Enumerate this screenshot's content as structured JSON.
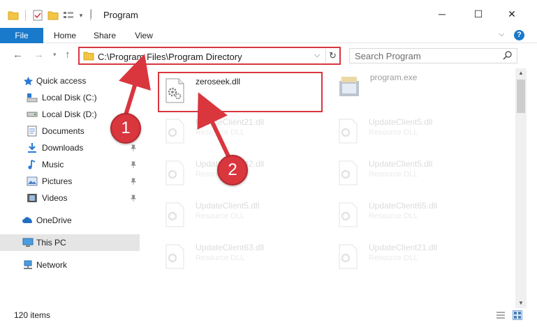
{
  "window": {
    "title": "Program",
    "minimize_glyph": "─",
    "maximize_glyph": "☐",
    "close_glyph": "✕"
  },
  "ribbon": {
    "tabs": [
      "File",
      "Home",
      "Share",
      "View"
    ],
    "expand_glyph": "⌵",
    "help_glyph": "?"
  },
  "nav": {
    "back_glyph": "←",
    "forward_glyph": "→",
    "recent_glyph": "▾",
    "up_glyph": "↑",
    "address": "C:\\Program Files\\Program Directory",
    "address_dropdown_glyph": "⌵",
    "refresh_glyph": "↻",
    "search_placeholder": "Search Program"
  },
  "sidebar": {
    "items": [
      {
        "label": "Quick access",
        "icon": "star-icon"
      },
      {
        "label": "Local Disk (C:)",
        "icon": "drive-c-icon"
      },
      {
        "label": "Local Disk (D:)",
        "icon": "drive-icon"
      },
      {
        "label": "Documents",
        "icon": "documents-icon"
      },
      {
        "label": "Downloads",
        "icon": "downloads-icon"
      },
      {
        "label": "Music",
        "icon": "music-icon"
      },
      {
        "label": "Pictures",
        "icon": "pictures-icon"
      },
      {
        "label": "Videos",
        "icon": "videos-icon"
      },
      {
        "label": "OneDrive",
        "icon": "onedrive-icon"
      },
      {
        "label": "This PC",
        "icon": "this-pc-icon"
      },
      {
        "label": "Network",
        "icon": "network-icon"
      }
    ]
  },
  "files": [
    {
      "name": "zeroseek.dll",
      "type": ""
    },
    {
      "name": "program.exe",
      "type": ""
    },
    {
      "name": "UpdateClient21.dll",
      "type": "Resource DLL"
    },
    {
      "name": "UpdateClient5.dll",
      "type": "Resource DLL"
    },
    {
      "name": "UpdateClient42.dll",
      "type": "Resource DLL"
    },
    {
      "name": "UpdateClient5.dll",
      "type": "Resource DLL"
    },
    {
      "name": "UpdateClient5.dll",
      "type": "Resource DLL"
    },
    {
      "name": "UpdateClient65.dll",
      "type": "Resource DLL"
    },
    {
      "name": "UpdateClient63.dll",
      "type": "Resource DLL"
    },
    {
      "name": "UpdateClient21.dll",
      "type": "Resource DLL"
    }
  ],
  "status": {
    "item_count": "120 items"
  },
  "annotations": {
    "step1": "1",
    "step2": "2"
  },
  "colors": {
    "accent": "#1979ca",
    "highlight_red": "#d9363e",
    "folder_yellow": "#f3c545"
  }
}
